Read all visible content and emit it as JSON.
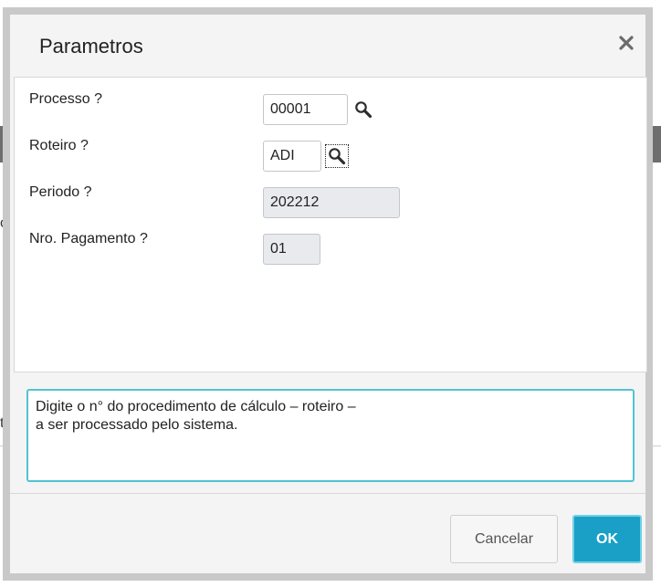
{
  "dialog": {
    "title": "Parametros",
    "close_icon": "close-icon"
  },
  "background": {
    "char_left_top": "o",
    "char_left_bottom": "t"
  },
  "params": [
    {
      "label": "Processo ?",
      "value": "00001",
      "editable": true,
      "lookup": true
    },
    {
      "label": "Roteiro ?",
      "value": "ADI",
      "editable": true,
      "lookup": true
    },
    {
      "label": "Periodo ?",
      "value": "202212",
      "editable": false,
      "lookup": false
    },
    {
      "label": "Nro. Pagamento ?",
      "value": "01",
      "editable": false,
      "lookup": false
    }
  ],
  "help": {
    "line1": "Digite o n° do procedimento de cálculo – roteiro –",
    "line2": "a ser processado pelo sistema."
  },
  "buttons": {
    "cancel_label": "Cancelar",
    "ok_label": "OK"
  },
  "colors": {
    "accent": "#1aa0c7",
    "help_border": "#52c3d2",
    "disabled_field": "#e8eaee"
  }
}
